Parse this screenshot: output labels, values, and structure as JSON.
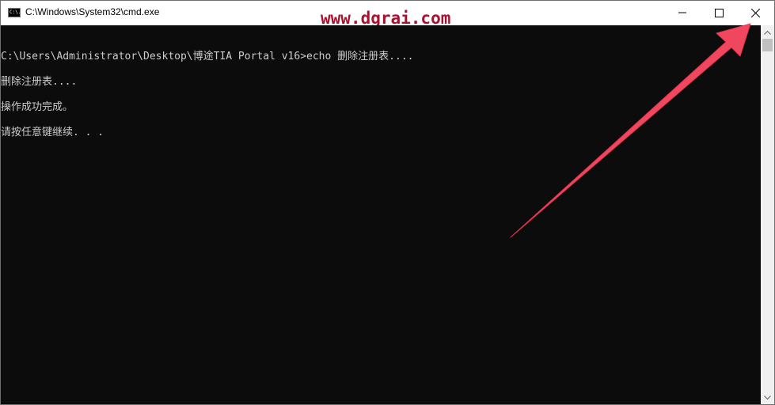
{
  "window": {
    "title": "C:\\Windows\\System32\\cmd.exe",
    "icon_label": "C:\\."
  },
  "watermark": "www.dgrai.com",
  "controls": {
    "minimize": "minimize-icon",
    "maximize": "maximize-icon",
    "close": "close-icon"
  },
  "console": {
    "lines": [
      "C:\\Users\\Administrator\\Desktop\\博途TIA Portal v16>echo 删除注册表....",
      "删除注册表....",
      "操作成功完成。",
      "请按任意键继续. . ."
    ]
  },
  "annotation": {
    "arrow_color": "#f0475f",
    "arrow": "arrow-icon"
  }
}
